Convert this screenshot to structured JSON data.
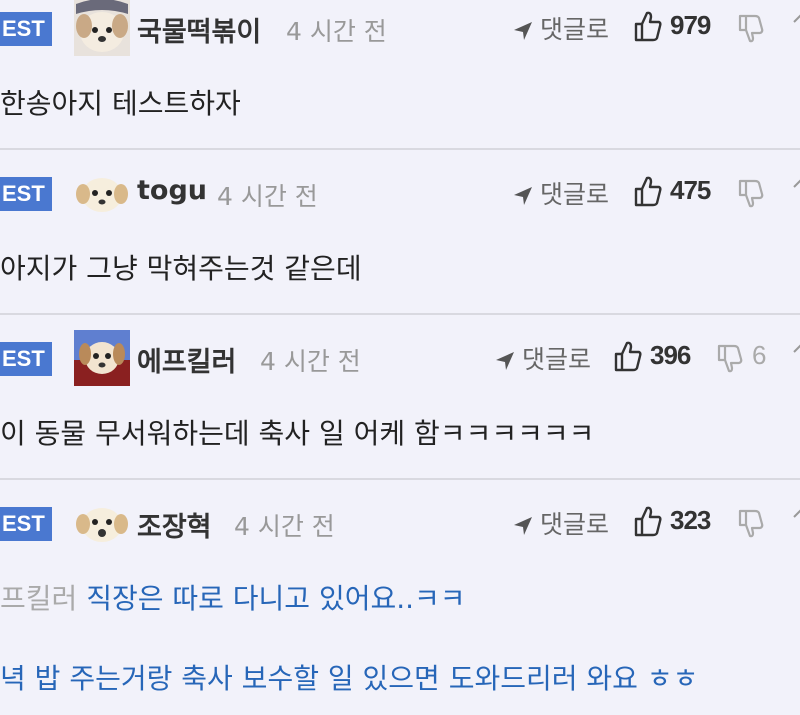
{
  "comments": [
    {
      "badge": "EST",
      "nickname": "국물떡볶이",
      "time": "4 시간 전",
      "reply_label": "댓글로",
      "likes": "979",
      "dislikes": "",
      "text": "한송아지 테스트하자"
    },
    {
      "badge": "EST",
      "nickname": "togu",
      "time": "4 시간 전",
      "reply_label": "댓글로",
      "likes": "475",
      "dislikes": "",
      "text": "아지가 그냥 막혀주는것 같은데"
    },
    {
      "badge": "EST",
      "nickname": "에프킬러",
      "time": "4 시간 전",
      "reply_label": "댓글로",
      "likes": "396",
      "dislikes": "6",
      "text": "이 동물 무서워하는데 축사 일 어케 함ㅋㅋㅋㅋㅋㅋ"
    },
    {
      "badge": "EST",
      "nickname": "조장혁",
      "time": "4 시간 전",
      "reply_label": "댓글로",
      "likes": "323",
      "dislikes": "",
      "reply_to": "프킬러",
      "text_line1": "직장은 따로 다니고 있어요..ㅋㅋ",
      "text_line2": "녁 밥 주는거랑 축사 보수할 일 있으면 도와드리러 와요 ㅎㅎ"
    }
  ],
  "icons": {
    "reply": "reply-arrow-icon",
    "like": "thumbs-up-icon",
    "dislike": "thumbs-down-icon",
    "more": "more-icon"
  },
  "colors": {
    "badge": "#4a78d0",
    "background": "#f2f2fa",
    "reply_text": "#2766b8"
  }
}
